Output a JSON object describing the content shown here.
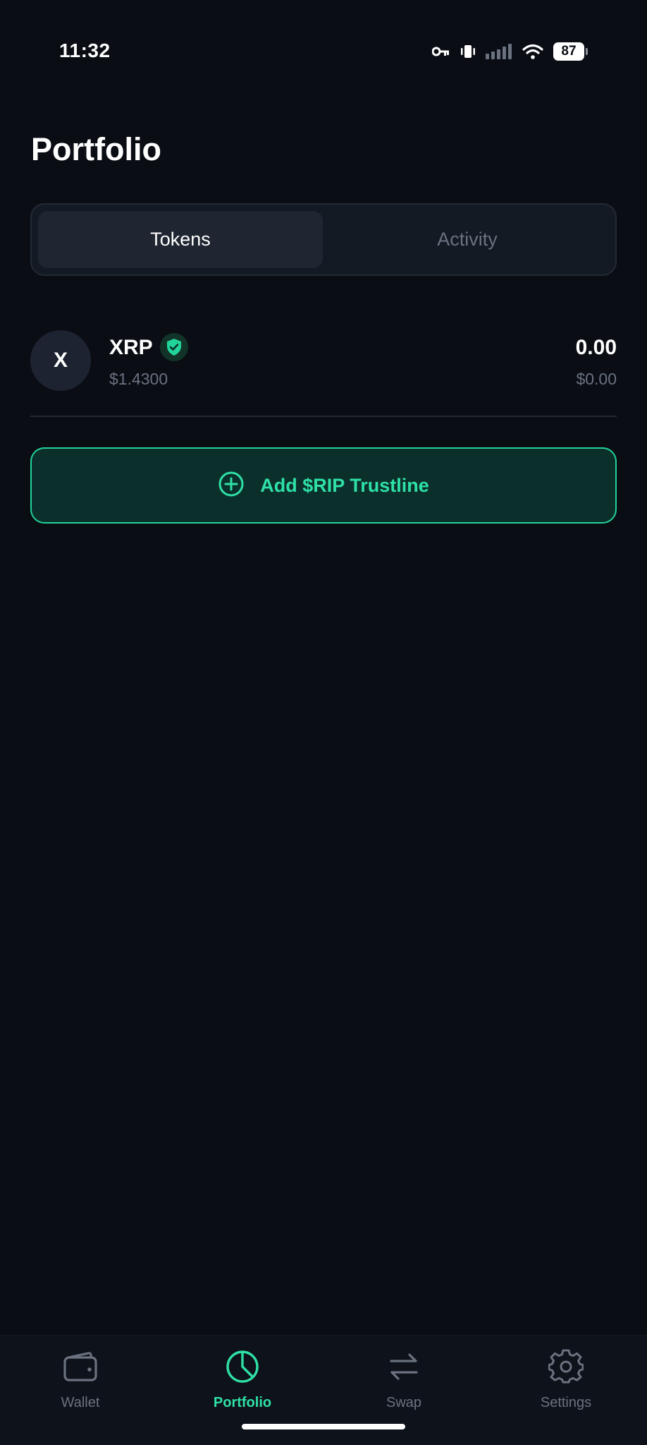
{
  "status_bar": {
    "time": "11:32",
    "battery": "87",
    "icons": [
      "key-icon",
      "vibrate-icon",
      "signal-icon",
      "wifi-icon",
      "battery-icon"
    ]
  },
  "page": {
    "title": "Portfolio"
  },
  "tabs": [
    {
      "label": "Tokens",
      "active": true
    },
    {
      "label": "Activity",
      "active": false
    }
  ],
  "tokens": [
    {
      "avatar_letter": "X",
      "symbol": "XRP",
      "verified": true,
      "price": "$1.4300",
      "balance": "0.00",
      "value": "$0.00"
    }
  ],
  "actions": {
    "add_trustline_label": "Add $RIP Trustline",
    "add_trustline_icon": "plus-circle-icon"
  },
  "bottom_nav": [
    {
      "label": "Wallet",
      "icon": "wallet-icon",
      "active": false
    },
    {
      "label": "Portfolio",
      "icon": "pie-chart-icon",
      "active": true
    },
    {
      "label": "Swap",
      "icon": "swap-arrows-icon",
      "active": false
    },
    {
      "label": "Settings",
      "icon": "gear-icon",
      "active": false
    }
  ],
  "colors": {
    "background": "#0a0d14",
    "accent": "#2fe0a6",
    "muted_text": "#6a7280",
    "button_bg": "#0b302c"
  }
}
